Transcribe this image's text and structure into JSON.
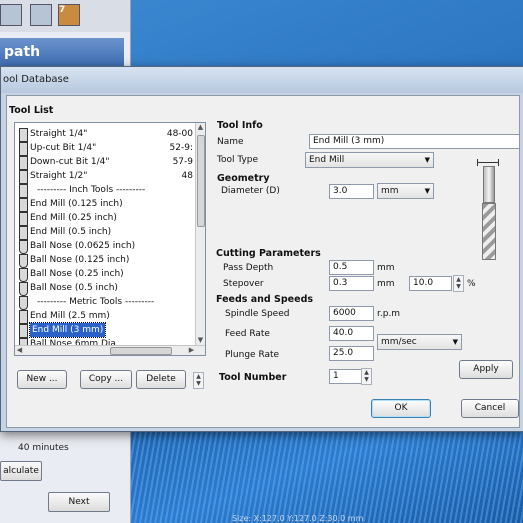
{
  "background": {
    "toolbar_badge": "7",
    "header": "path",
    "minutes": "40 minutes",
    "calculate_label": "alculate",
    "next_label": "Next",
    "status": "Size: X:127.0 Y:127.0 Z:30.0 mm"
  },
  "dialog": {
    "title": "ool Database",
    "tool_list_label": "Tool List",
    "tools": [
      {
        "name": "Straight 1/4\"",
        "num": "48-00",
        "icon": "flat-bit-icon",
        "type": "tool"
      },
      {
        "name": "Up-cut Bit 1/4\"",
        "num": "52-9:",
        "icon": "flat-bit-icon",
        "type": "tool"
      },
      {
        "name": "Down-cut Bit 1/4\"",
        "num": "57-9",
        "icon": "flat-bit-icon",
        "type": "tool"
      },
      {
        "name": "Straight 1/2\"",
        "num": "48",
        "icon": "flat-bit-icon",
        "type": "tool"
      },
      {
        "name": "--------- Inch Tools ---------",
        "num": "",
        "icon": "flat-bit-icon",
        "type": "group"
      },
      {
        "name": "End Mill (0.125 inch)",
        "num": "",
        "icon": "flat-bit-icon",
        "type": "tool"
      },
      {
        "name": "End Mill (0.25 inch)",
        "num": "",
        "icon": "flat-bit-icon",
        "type": "tool"
      },
      {
        "name": "End Mill (0.5 inch)",
        "num": "",
        "icon": "flat-bit-icon",
        "type": "tool"
      },
      {
        "name": "Ball Nose (0.0625 inch)",
        "num": "",
        "icon": "ball-bit-icon",
        "type": "tool"
      },
      {
        "name": "Ball Nose (0.125 inch)",
        "num": "",
        "icon": "ball-bit-icon",
        "type": "tool"
      },
      {
        "name": "Ball Nose (0.25 inch)",
        "num": "",
        "icon": "ball-bit-icon",
        "type": "tool"
      },
      {
        "name": "Ball Nose (0.5 inch)",
        "num": "",
        "icon": "ball-bit-icon",
        "type": "tool"
      },
      {
        "name": "--------- Metric Tools ---------",
        "num": "",
        "icon": "ball-bit-icon",
        "type": "group"
      },
      {
        "name": "End Mill (2.5 mm)",
        "num": "",
        "icon": "flat-bit-icon",
        "type": "tool"
      },
      {
        "name": "End Mill (3 mm)",
        "num": "",
        "icon": "flat-bit-icon",
        "type": "selected"
      },
      {
        "name": "Ball Nose 6mm Dia",
        "num": "",
        "icon": "ball-bit-icon",
        "type": "tool"
      }
    ],
    "buttons": {
      "new": "New ...",
      "copy": "Copy ...",
      "delete": "Delete",
      "apply": "Apply",
      "ok": "OK",
      "cancel": "Cancel"
    },
    "tool_info": {
      "heading": "Tool Info",
      "name_label": "Name",
      "name_value": "End Mill (3 mm)",
      "type_label": "Tool Type",
      "type_value": "End Mill"
    },
    "geometry": {
      "heading": "Geometry",
      "diameter_label": "Diameter (D)",
      "diameter_value": "3.0",
      "diameter_unit": "mm"
    },
    "cutting": {
      "heading": "Cutting Parameters",
      "pass_depth_label": "Pass Depth",
      "pass_depth_value": "0.5",
      "pass_depth_unit": "mm",
      "stepover_label": "Stepover",
      "stepover_value": "0.3",
      "stepover_unit": "mm",
      "stepover_pct_value": "10.0",
      "stepover_pct_unit": "%"
    },
    "feeds": {
      "heading": "Feeds and Speeds",
      "spindle_label": "Spindle Speed",
      "spindle_value": "6000",
      "spindle_unit": "r.p.m",
      "feed_label": "Feed Rate",
      "feed_value": "40.0",
      "feed_unit": "mm/sec",
      "plunge_label": "Plunge Rate",
      "plunge_value": "25.0"
    },
    "tool_number": {
      "label": "Tool Number",
      "value": "1"
    }
  }
}
